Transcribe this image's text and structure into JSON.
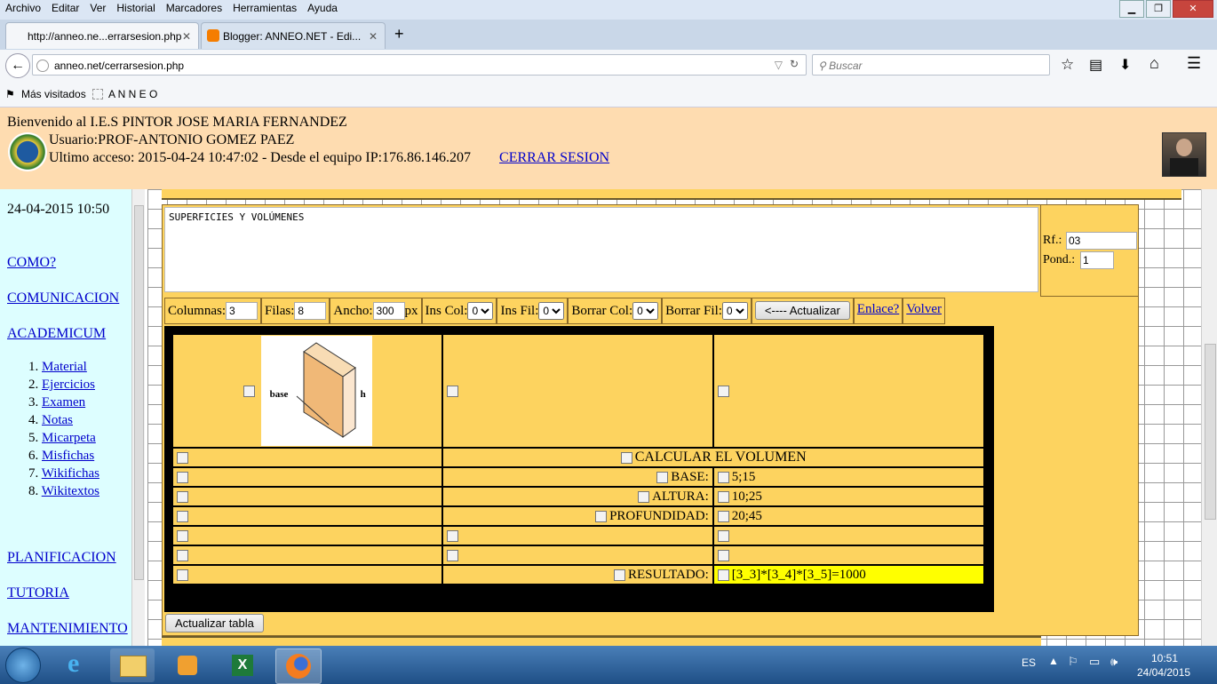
{
  "menu": [
    "Archivo",
    "Editar",
    "Ver",
    "Historial",
    "Marcadores",
    "Herramientas",
    "Ayuda"
  ],
  "tabs": [
    {
      "title": "http://anneo.ne...errarsesion.php",
      "close": "✕"
    },
    {
      "title": "Blogger: ANNEO.NET - Edi...",
      "close": "✕"
    }
  ],
  "new_tab": "+",
  "url": "anneo.net/cerrarsesion.php",
  "search_placeholder": "Buscar",
  "bookmarks": [
    "Más visitados",
    "A N N E O"
  ],
  "header": {
    "welcome": "Bienvenido al I.E.S PINTOR JOSE MARIA FERNANDEZ",
    "user": "Usuario:PROF-ANTONIO GOMEZ PAEZ",
    "last_access": "Ultimo acceso: 2015-04-24 10:47:02 - Desde el equipo IP:176.86.146.207",
    "logout": "CERRAR SESION"
  },
  "sidebar": {
    "datetime": "24-04-2015 10:50",
    "links_top": [
      "COMO?",
      "COMUNICACION",
      "ACADEMICUM"
    ],
    "academicum_items": [
      "Material",
      "Ejercicios",
      "Examen",
      "Notas",
      "Micarpeta",
      "Misfichas",
      "Wikifichas",
      "Wikitextos"
    ],
    "links_bottom": [
      "PLANIFICACION",
      "TUTORIA",
      "MANTENIMIENTO"
    ]
  },
  "editor": {
    "text": "SUPERFICIES Y VOLÚMENES",
    "rf_label": "Rf.:",
    "rf_value": "03",
    "pond_label": "Pond.:",
    "pond_value": "1",
    "columns_label": "Columnas:",
    "columns_value": "3",
    "rows_label": "Filas:",
    "rows_value": "8",
    "width_label": "Ancho:",
    "width_value": "300",
    "width_unit": "px",
    "inscol_label": "Ins Col:",
    "insfil_label": "Ins Fil:",
    "borcol_label": "Borrar Col:",
    "borfil_label": "Borrar Fil:",
    "select_value": "0",
    "update_btn": "<---- Actualizar",
    "link_enlace": "Enlace?",
    "link_volver": "Volver",
    "update_table_btn": "Actualizar tabla"
  },
  "figure": {
    "base": "base",
    "h": "h"
  },
  "table": [
    [
      "",
      "CALCULAR EL VOLUMEN",
      ""
    ],
    [
      "",
      "BASE:",
      "5;15"
    ],
    [
      "",
      "ALTURA:",
      "10;25"
    ],
    [
      "",
      "PROFUNDIDAD:",
      "20;45"
    ],
    [
      "",
      "",
      ""
    ],
    [
      "",
      "",
      ""
    ],
    [
      "",
      "RESULTADO:",
      "[3_3]*[3_4]*[3_5]=1000"
    ]
  ],
  "colors": {
    "result_bg": "#ffff00",
    "cell_bg": "#fdd35f",
    "header_bg": "#fedcb0",
    "sidebar_bg": "#ddfeff"
  },
  "taskbar": {
    "lang": "ES",
    "time": "10:51",
    "date": "24/04/2015"
  }
}
